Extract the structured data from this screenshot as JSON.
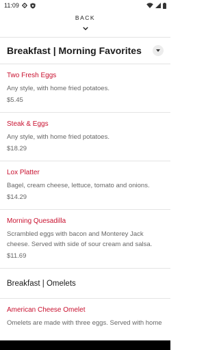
{
  "status": {
    "time": "11:09"
  },
  "icons": {
    "settings": "gear-icon",
    "shield": "shield-icon",
    "wifi": "wifi-icon",
    "signal": "signal-icon",
    "battery": "battery-icon",
    "chevron_down": "chevron-down-icon",
    "caret_down": "caret-down-icon"
  },
  "colors": {
    "accent": "#c8102e",
    "text": "#1a1a1a",
    "muted": "#666666"
  },
  "header": {
    "back_label": "BACK"
  },
  "section": {
    "title": "Breakfast | Morning Favorites"
  },
  "items": [
    {
      "name": "Two Fresh Eggs",
      "description": "Any style, with home fried potatoes.",
      "price": "$5.45"
    },
    {
      "name": "Steak & Eggs",
      "description": "Any style, with home fried potatoes.",
      "price": "$18.29"
    },
    {
      "name": "Lox Platter",
      "description": "Bagel, cream cheese, lettuce, tomato and onions.",
      "price": "$14.29"
    },
    {
      "name": "Morning Quesadilla",
      "description": "Scrambled eggs with bacon and Monterey Jack cheese. Served with side of sour cream and salsa.",
      "price": "$11.69"
    }
  ],
  "subsection": {
    "title": "Breakfast | Omelets"
  },
  "last_item": {
    "name": "American Cheese Omelet",
    "description": "Omelets are made with three eggs. Served with home fries, buttered toast and jelly."
  }
}
